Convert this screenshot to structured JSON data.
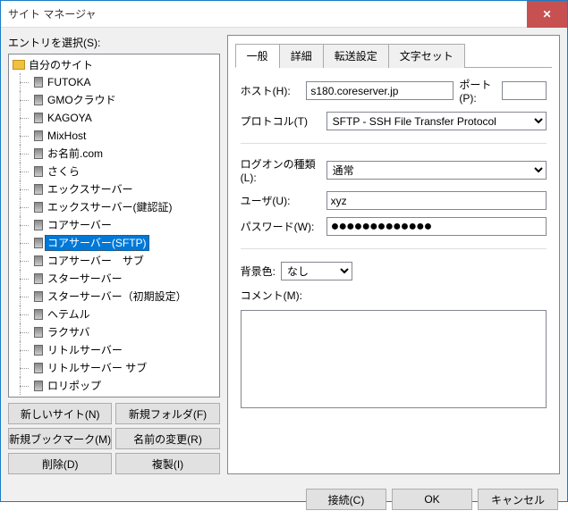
{
  "window": {
    "title": "サイト マネージャ"
  },
  "left": {
    "entry_label": "エントリを選択(S):",
    "root": "自分のサイト",
    "items": [
      "FUTOKA",
      "GMOクラウド",
      "KAGOYA",
      "MixHost",
      "お名前.com",
      "さくら",
      "エックスサーバー",
      "エックスサーバー(鍵認証)",
      "コアサーバー",
      "コアサーバー(SFTP)",
      "コアサーバー　サブ",
      "スターサーバー",
      "スターサーバー（初期設定）",
      "ヘテムル",
      "ラクサバ",
      "リトルサーバー",
      "リトルサーバー サブ",
      "ロリポップ"
    ],
    "selected_index": 9,
    "buttons": {
      "new_site": "新しいサイト(N)",
      "new_folder": "新規フォルダ(F)",
      "new_bookmark": "新規ブックマーク(M)",
      "rename": "名前の変更(R)",
      "delete": "削除(D)",
      "duplicate": "複製(I)"
    }
  },
  "tabs": {
    "general": "一般",
    "detail": "詳細",
    "transfer": "転送設定",
    "charset": "文字セット",
    "active": 0
  },
  "form": {
    "host_label": "ホスト(H):",
    "host_value": "s180.coreserver.jp",
    "port_label": "ポート(P):",
    "port_value": "",
    "protocol_label": "プロトコル(T)",
    "protocol_value": "SFTP - SSH File Transfer Protocol",
    "logon_label": "ログオンの種類(L):",
    "logon_value": "通常",
    "user_label": "ユーザ(U):",
    "user_value": "xyz",
    "password_label": "パスワード(W):",
    "password_value": "●●●●●●●●●●●●●",
    "bgcolor_label": "背景色:",
    "bgcolor_value": "なし",
    "comment_label": "コメント(M):",
    "comment_value": ""
  },
  "footer": {
    "connect": "接続(C)",
    "ok": "OK",
    "cancel": "キャンセル"
  }
}
